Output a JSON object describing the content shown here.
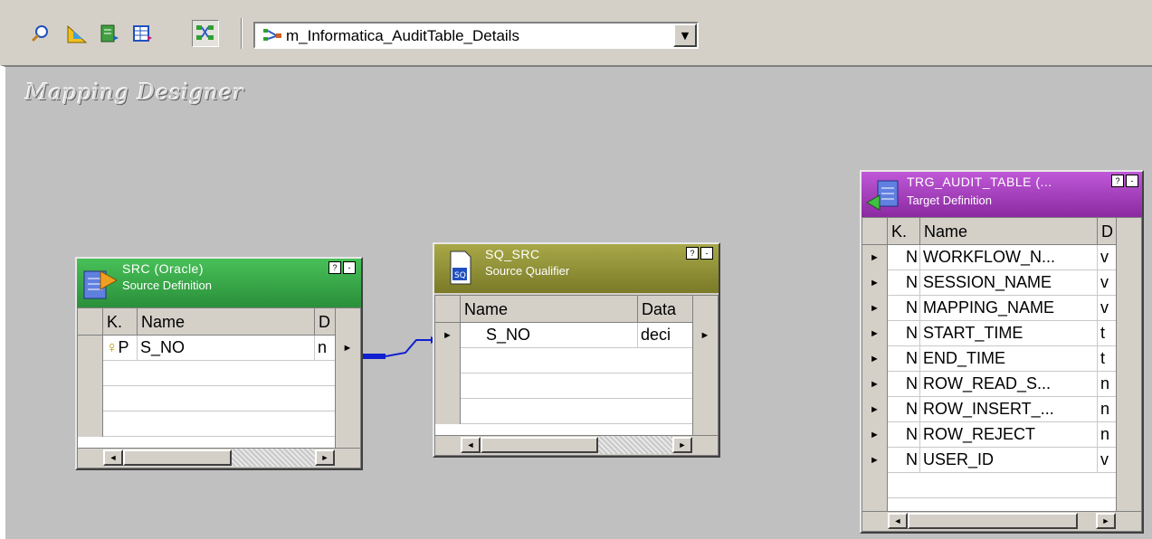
{
  "toolbar": {
    "icons": [
      "find-icon",
      "source-analyzer-icon",
      "target-designer-icon",
      "transformation-developer-icon",
      "mapping-designer-icon"
    ],
    "mapping_selector": {
      "value": "m_Informatica_AuditTable_Details"
    }
  },
  "canvas": {
    "title": "Mapping Designer"
  },
  "source_def": {
    "title": "SRC (Oracle)",
    "subtitle": "Source Definition",
    "headers": [
      "K.",
      "Name",
      "D"
    ],
    "rows": [
      {
        "key": "P",
        "name": "S_NO",
        "type": "n"
      }
    ],
    "color": "#3aa648"
  },
  "source_qualifier": {
    "title": "SQ_SRC",
    "subtitle": "Source Qualifier",
    "headers": [
      "Name",
      "Data"
    ],
    "rows": [
      {
        "name": "S_NO",
        "type": "deci"
      }
    ],
    "color": "#8b8b3a"
  },
  "target_def": {
    "title": "TRG_AUDIT_TABLE (...",
    "subtitle": "Target Definition",
    "headers": [
      "K.",
      "Name",
      "D"
    ],
    "rows": [
      {
        "key": "N",
        "name": "WORKFLOW_N...",
        "type": "v"
      },
      {
        "key": "N",
        "name": "SESSION_NAME",
        "type": "v"
      },
      {
        "key": "N",
        "name": "MAPPING_NAME",
        "type": "v"
      },
      {
        "key": "N",
        "name": "START_TIME",
        "type": "t"
      },
      {
        "key": "N",
        "name": "END_TIME",
        "type": "t"
      },
      {
        "key": "N",
        "name": "ROW_READ_S...",
        "type": "n"
      },
      {
        "key": "N",
        "name": "ROW_INSERT_...",
        "type": "n"
      },
      {
        "key": "N",
        "name": "ROW_REJECT",
        "type": "n"
      },
      {
        "key": "N",
        "name": "USER_ID",
        "type": "v"
      }
    ],
    "color": "#a03ab8"
  },
  "header_buttons": {
    "help": "?",
    "minimize": "-"
  }
}
